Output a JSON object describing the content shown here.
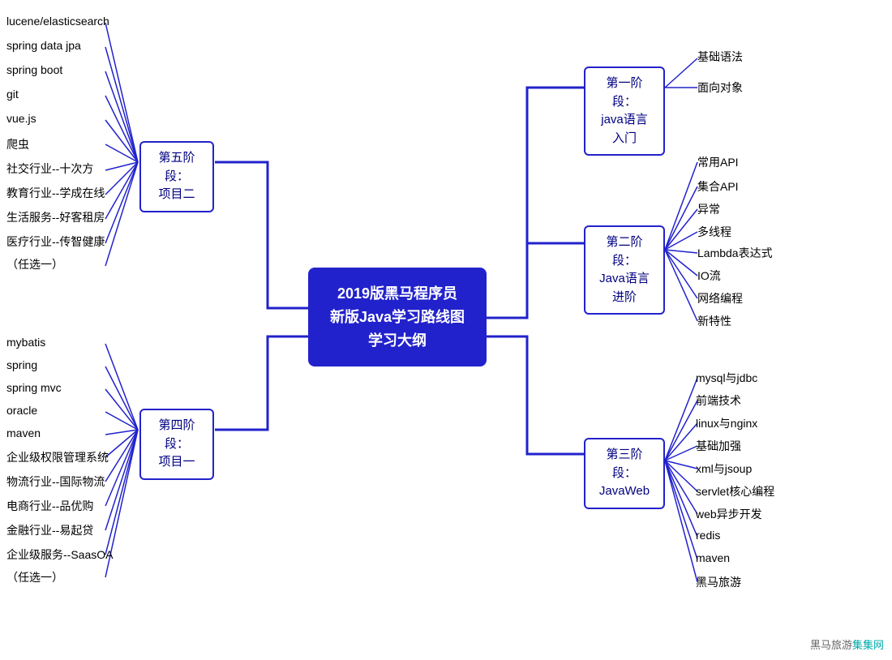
{
  "center": {
    "line1": "2019版黑马程序员",
    "line2": "新版Java学习路线图学习大纲"
  },
  "right_branches": [
    {
      "id": "stage1",
      "label_line1": "第一阶段：",
      "label_line2": "java语言入门",
      "leaves": [
        "基础语法",
        "面向对象"
      ]
    },
    {
      "id": "stage2",
      "label_line1": "第二阶段：",
      "label_line2": "Java语言进阶",
      "leaves": [
        "常用API",
        "集合API",
        "异常",
        "多线程",
        "Lambda表达式",
        "IO流",
        "网络编程",
        "新特性"
      ]
    },
    {
      "id": "stage3",
      "label_line1": "第三阶段：",
      "label_line2": "JavaWeb",
      "leaves": [
        "mysql与jdbc",
        "前端技术",
        "linux与nginx",
        "基础加强",
        "xml与jsoup",
        "servlet核心编程",
        "web异步开发",
        "redis",
        "maven",
        "黑马旅游"
      ]
    }
  ],
  "left_branches": [
    {
      "id": "stage5",
      "label_line1": "第五阶段：",
      "label_line2": "项目二",
      "leaves": [
        "lucene/elasticsearch",
        "spring data jpa",
        "spring boot",
        "git",
        "vue.js",
        "爬虫",
        "社交行业--十次方",
        "教育行业--学成在线",
        "生活服务--好客租房",
        "医疗行业--传智健康",
        "（任选一）"
      ]
    },
    {
      "id": "stage4",
      "label_line1": "第四阶段：",
      "label_line2": "项目一",
      "leaves": [
        "mybatis",
        "spring",
        "spring mvc",
        "oracle",
        "maven",
        "企业级权限管理系统",
        "物流行业--国际物流",
        "电商行业--品优购",
        "金融行业--易起贷",
        "企业级服务--SaasOA",
        "（任选一）"
      ]
    }
  ],
  "watermark": "集集网"
}
